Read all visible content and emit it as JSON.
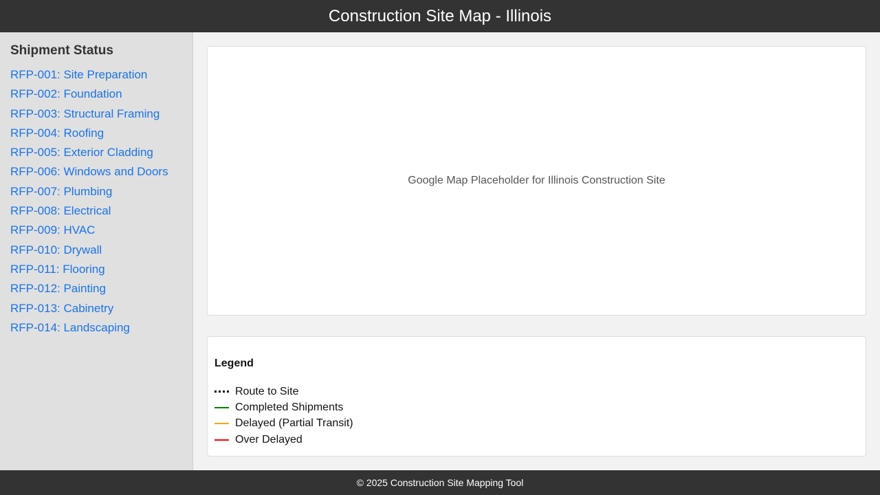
{
  "header": {
    "title": "Construction Site Map - Illinois"
  },
  "sidebar": {
    "title": "Shipment Status",
    "items": [
      {
        "label": "RFP-001: Site Preparation"
      },
      {
        "label": "RFP-002: Foundation"
      },
      {
        "label": "RFP-003: Structural Framing"
      },
      {
        "label": "RFP-004: Roofing"
      },
      {
        "label": "RFP-005: Exterior Cladding"
      },
      {
        "label": "RFP-006: Windows and Doors"
      },
      {
        "label": "RFP-007: Plumbing"
      },
      {
        "label": "RFP-008: Electrical"
      },
      {
        "label": "RFP-009: HVAC"
      },
      {
        "label": "RFP-010: Drywall"
      },
      {
        "label": "RFP-011: Flooring"
      },
      {
        "label": "RFP-012: Painting"
      },
      {
        "label": "RFP-013: Cabinetry"
      },
      {
        "label": "RFP-014: Landscaping"
      }
    ]
  },
  "map": {
    "placeholder": "Google Map Placeholder for Illinois Construction Site"
  },
  "legend": {
    "title": "Legend",
    "items": [
      {
        "label": "Route to Site",
        "color": "#000000",
        "style": "dotted"
      },
      {
        "label": "Completed Shipments",
        "color": "#008000",
        "style": "solid"
      },
      {
        "label": "Delayed (Partial Transit)",
        "color": "#ffa500",
        "style": "solid"
      },
      {
        "label": "Over Delayed",
        "color": "#ff0000",
        "style": "solid"
      }
    ]
  },
  "footer": {
    "text": "© 2025 Construction Site Mapping Tool"
  }
}
